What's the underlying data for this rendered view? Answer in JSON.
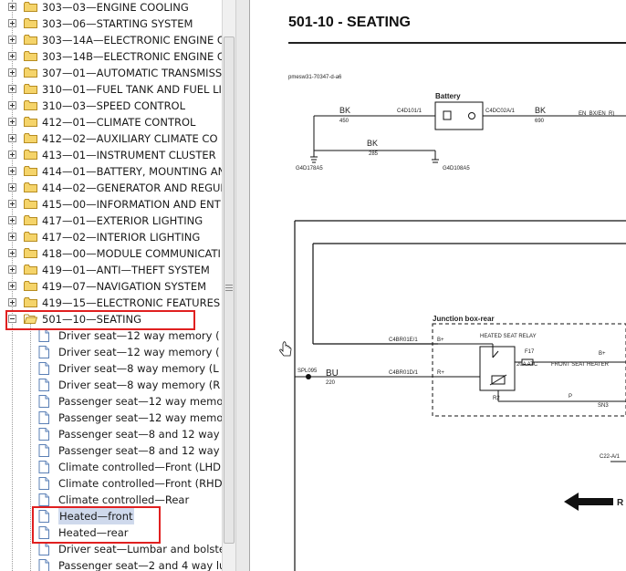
{
  "tree": {
    "folders_above": [
      {
        "label": "303—03—ENGINE COOLING"
      },
      {
        "label": "303—06—STARTING SYSTEM"
      },
      {
        "label": "303—14A—ELECTRONIC ENGINE C"
      },
      {
        "label": "303—14B—ELECTRONIC ENGINE C"
      },
      {
        "label": "307—01—AUTOMATIC TRANSMISS"
      },
      {
        "label": "310—01—FUEL TANK AND FUEL LI"
      },
      {
        "label": "310—03—SPEED CONTROL"
      },
      {
        "label": "412—01—CLIMATE CONTROL"
      },
      {
        "label": "412—02—AUXILIARY CLIMATE CO"
      },
      {
        "label": "413—01—INSTRUMENT CLUSTER"
      },
      {
        "label": "414—01—BATTERY, MOUNTING AN"
      },
      {
        "label": "414—02—GENERATOR AND REGUL"
      },
      {
        "label": "415—00—INFORMATION AND ENT"
      },
      {
        "label": "417—01—EXTERIOR LIGHTING"
      },
      {
        "label": "417—02—INTERIOR LIGHTING"
      },
      {
        "label": "418—00—MODULE COMMUNICATI"
      },
      {
        "label": "419—01—ANTI—THEFT SYSTEM"
      },
      {
        "label": "419—07—NAVIGATION SYSTEM"
      },
      {
        "label": "419—15—ELECTRONIC FEATURES"
      }
    ],
    "open_folder": {
      "label": "501—10—SEATING"
    },
    "docs": [
      {
        "label": "Driver seat—12 way memory ("
      },
      {
        "label": "Driver seat—12 way memory ("
      },
      {
        "label": "Driver seat—8 way memory (L"
      },
      {
        "label": "Driver seat—8 way memory (R"
      },
      {
        "label": "Passenger seat—12 way memo"
      },
      {
        "label": "Passenger seat—12 way memo"
      },
      {
        "label": "Passenger seat—8 and 12 way"
      },
      {
        "label": "Passenger seat—8 and 12 way"
      },
      {
        "label": "Climate controlled—Front (LHD"
      },
      {
        "label": "Climate controlled—Front (RHD"
      },
      {
        "label": "Climate controlled—Rear"
      },
      {
        "label": "Heated—front"
      },
      {
        "label": "Heated—rear"
      },
      {
        "label": "Driver seat—Lumbar and bolste"
      },
      {
        "label": "Passenger seat—2 and 4 way lu"
      }
    ]
  },
  "document": {
    "title": "501-10 - SEATING",
    "diagram_code": "pmesw31-70347-d-a6",
    "battery_label": "Battery",
    "wire_bk_left": "BK",
    "wire_bk_left_num": "450",
    "conn_c4d101": "C4D101/1",
    "conn_c4dc02a": "C4DC02A/1",
    "wire_bk_right": "BK",
    "wire_bk_right_num": "690",
    "en_bat": "EN_BX/EN_R)",
    "wire_bk_mid": "BK",
    "wire_bk_mid_num": "285",
    "ground_left": "G4D178A5",
    "ground_right": "G4D108A5",
    "junction_box": "Junction box-rear",
    "relay_label": "HEATED SEAT RELAY",
    "conn_c4br01e": "C4BR01E/1",
    "pin_b1": "B+",
    "conn_c4br01d": "C4BR01D/1",
    "pin_r1": "R+",
    "splice": "SPL095",
    "wire_bu": "BU",
    "wire_bu_num": "220",
    "fuse": "F17",
    "fuse_rating": "20A ATC",
    "front_heater": "FRONT SEAT HEATER",
    "pin_b2": "B+",
    "relay_r2": "R2",
    "pin_p": "P",
    "sn_label": "SN3",
    "conn_c22": "C22-A/1",
    "arrow_label": "R"
  }
}
